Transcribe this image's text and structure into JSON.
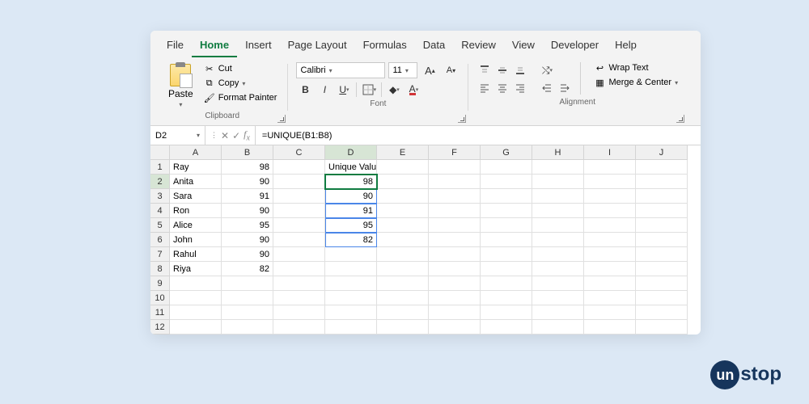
{
  "tabs": [
    "File",
    "Home",
    "Insert",
    "Page Layout",
    "Formulas",
    "Data",
    "Review",
    "View",
    "Developer",
    "Help"
  ],
  "active_tab": "Home",
  "ribbon": {
    "clipboard": {
      "label": "Clipboard",
      "paste": "Paste",
      "cut": "Cut",
      "copy": "Copy",
      "format_painter": "Format Painter"
    },
    "font": {
      "label": "Font",
      "name": "Calibri",
      "size": "11"
    },
    "alignment": {
      "label": "Alignment",
      "wrap": "Wrap Text",
      "merge": "Merge & Center"
    }
  },
  "name_box": "D2",
  "formula": "=UNIQUE(B1:B8)",
  "columns": [
    "A",
    "B",
    "C",
    "D",
    "E",
    "F",
    "G",
    "H",
    "I",
    "J"
  ],
  "rows": 12,
  "active_cell": {
    "row": 2,
    "col": "D"
  },
  "spill_range": {
    "col": "D",
    "from": 2,
    "to": 6
  },
  "cells": {
    "A1": "Ray",
    "B1": "98",
    "D1": "Unique Values",
    "A2": "Anita",
    "B2": "90",
    "D2": "98",
    "A3": "Sara",
    "B3": "91",
    "D3": "90",
    "A4": "Ron",
    "B4": "90",
    "D4": "91",
    "A5": "Alice",
    "B5": "95",
    "D5": "95",
    "A6": "John",
    "B6": "90",
    "D6": "82",
    "A7": "Rahul",
    "B7": "90",
    "A8": "Riya",
    "B8": "82"
  },
  "numeric_cols": [
    "B",
    "D"
  ],
  "logo": {
    "prefix": "un",
    "rest": "stop"
  }
}
